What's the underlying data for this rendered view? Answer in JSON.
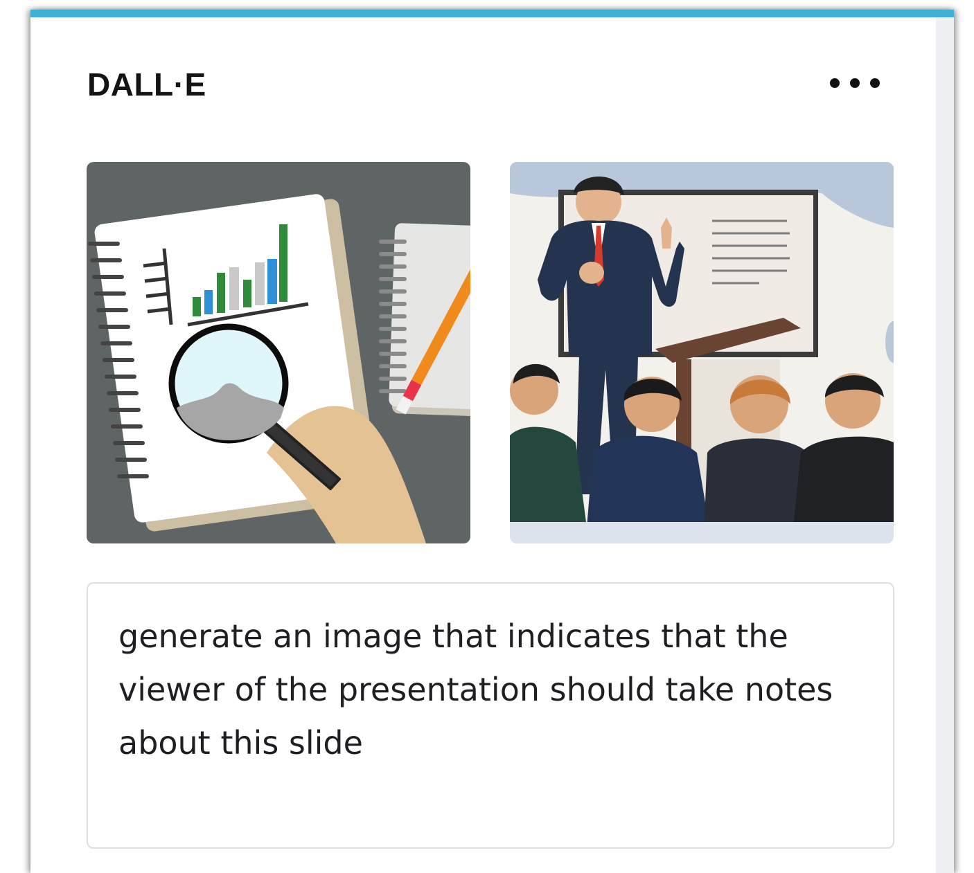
{
  "panel": {
    "title": "DALL·E",
    "menu_icon": "more-horizontal-icon",
    "accent_color": "#3fb0d6"
  },
  "images": [
    {
      "subject": "notebook-with-bar-chart-and-magnifying-glass"
    },
    {
      "subject": "presenter-at-whiteboard-with-audience"
    }
  ],
  "prompt": {
    "text": "generate an image that indicates that the viewer of the presentation should take notes about this slide"
  }
}
